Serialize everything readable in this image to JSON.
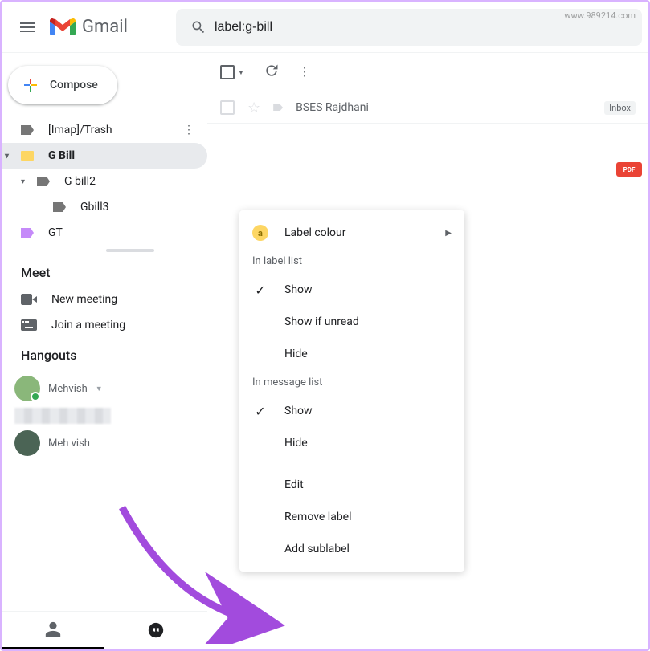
{
  "header": {
    "logo_text": "Gmail",
    "search_value": "label:g-bill"
  },
  "sidebar": {
    "compose_label": "Compose",
    "labels": [
      {
        "name": "[Imap]/Trash",
        "color": "grey"
      },
      {
        "name": "G Bill",
        "color": "yellow",
        "selected": true
      },
      {
        "name": "G bill2",
        "color": "grey",
        "sub": 1
      },
      {
        "name": "Gbill3",
        "color": "grey",
        "sub": 2
      },
      {
        "name": "GT",
        "color": "purple"
      }
    ],
    "meet_title": "Meet",
    "meet_new": "New meeting",
    "meet_join": "Join a meeting",
    "hangouts_title": "Hangouts",
    "contacts": [
      {
        "name": "Mehvish"
      },
      {
        "name": "Meh vish"
      }
    ]
  },
  "emails": [
    {
      "sender": "BSES Rajdhani",
      "badge": "Inbox"
    }
  ],
  "context_menu": {
    "label_colour": "Label colour",
    "section1": "In label list",
    "show": "Show",
    "show_unread": "Show if unread",
    "hide": "Hide",
    "section2": "In message list",
    "edit": "Edit",
    "remove": "Remove label",
    "add_sub": "Add sublabel"
  },
  "pdf_label": "PDF",
  "watermark": "www.989214.com"
}
